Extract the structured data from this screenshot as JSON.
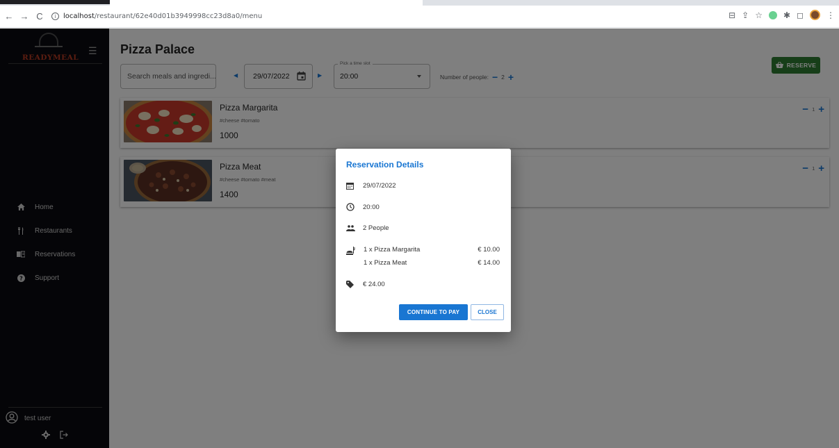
{
  "browser": {
    "url_host": "localhost",
    "url_path": "/restaurant/62e40d01b3949998cc23d8a0/menu"
  },
  "sidebar": {
    "logo_text": "READYMEAL",
    "items": [
      {
        "label": "Home",
        "icon": "home-icon"
      },
      {
        "label": "Restaurants",
        "icon": "cutlery-icon"
      },
      {
        "label": "Reservations",
        "icon": "book-icon"
      },
      {
        "label": "Support",
        "icon": "help-icon"
      }
    ],
    "user": {
      "name": "test user"
    }
  },
  "main": {
    "title": "Pizza Palace",
    "search": {
      "placeholder": "Search meals and ingredi..."
    },
    "date": {
      "value": "29/07/2022"
    },
    "time_slot": {
      "legend": "Pick a time slot",
      "value": "20:00"
    },
    "people": {
      "label": "Number of people:",
      "count": "2"
    },
    "reserve_label": "RESERVE",
    "meals": [
      {
        "name": "Pizza Margarita",
        "tags": "#cheese  #tomato",
        "price": "1000",
        "qty": "1"
      },
      {
        "name": "Pizza Meat",
        "tags": "#cheese  #tomato  #meat",
        "price": "1400",
        "qty": "1"
      }
    ]
  },
  "dialog": {
    "title": "Reservation Details",
    "date": "29/07/2022",
    "time": "20:00",
    "people": "2 People",
    "items": [
      {
        "name": "1 x Pizza Margarita",
        "price": "€ 10.00"
      },
      {
        "name": "1 x Pizza Meat",
        "price": "€ 14.00"
      }
    ],
    "total": "€ 24.00",
    "pay_label": "CONTINUE TO PAY",
    "close_label": "CLOSE"
  },
  "colors": {
    "primary": "#1976d2",
    "reserve": "#2e7d32",
    "sidebar_bg": "#0b0b10",
    "logo": "#b83a22"
  }
}
